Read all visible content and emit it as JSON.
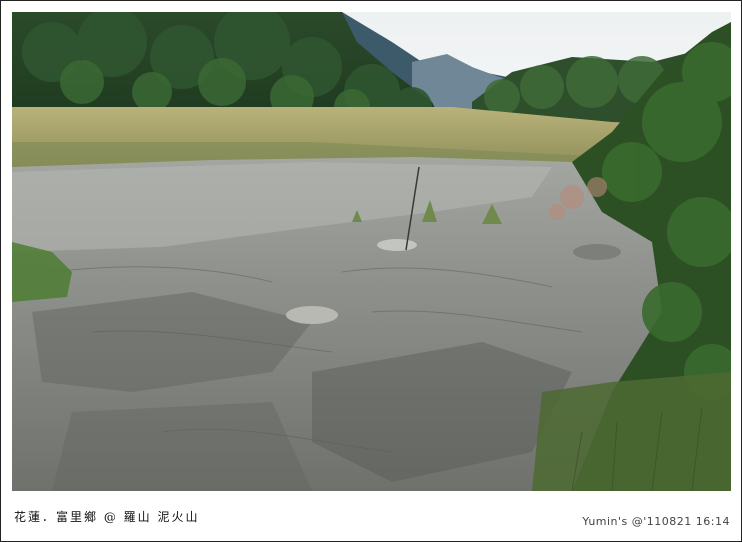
{
  "caption": {
    "location": "花蓮．富里鄉 @ 羅山 泥火山",
    "credit": "Yumin's @'110821 16:14"
  }
}
